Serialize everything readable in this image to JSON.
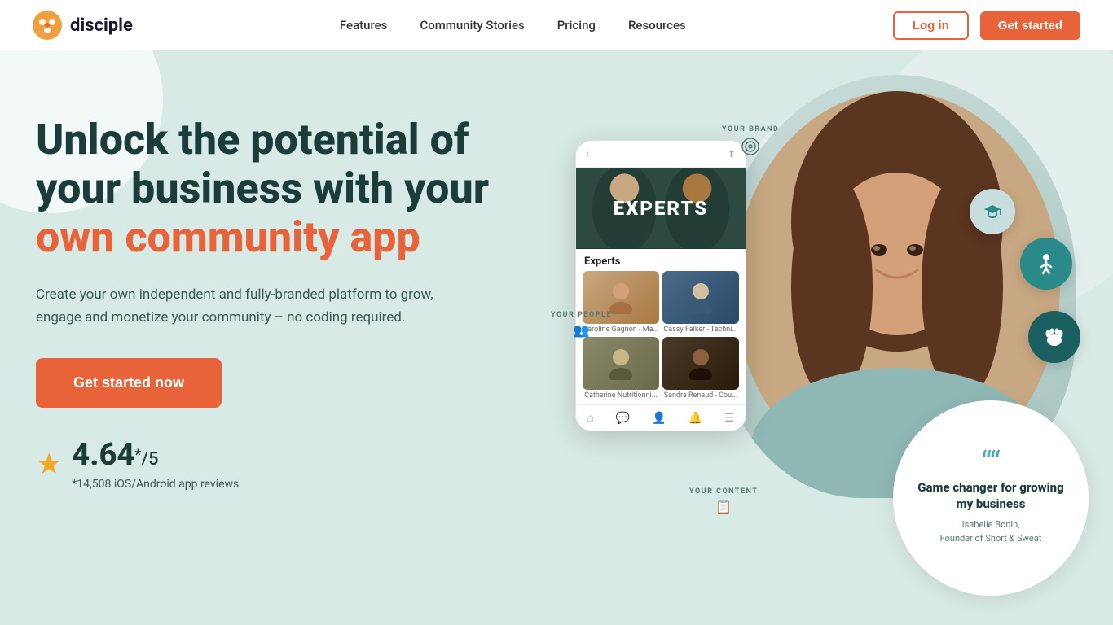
{
  "header": {
    "logo_text": "disciple",
    "nav": [
      {
        "label": "Features",
        "id": "features"
      },
      {
        "label": "Community Stories",
        "id": "community-stories"
      },
      {
        "label": "Pricing",
        "id": "pricing"
      },
      {
        "label": "Resources",
        "id": "resources"
      }
    ],
    "login_label": "Log in",
    "get_started_label": "Get started"
  },
  "hero": {
    "heading_line1": "Unlock the potential of",
    "heading_line2": "your business with your",
    "heading_accent": "own community app",
    "subtext": "Create your own independent and fully-branded platform to grow, engage and monetize your community – no coding required.",
    "cta_label": "Get started now",
    "rating_value": "4.64",
    "rating_sup": "*",
    "rating_denom": "/5",
    "rating_reviews": "*14,508 iOS/Android app reviews"
  },
  "phone": {
    "banner_text": "EXPERTS",
    "section_title": "Experts",
    "cards": [
      {
        "name": "Caroline Gagnon - Ma..."
      },
      {
        "name": "Cassy Falker - Techni..."
      },
      {
        "name": "Catherine Nutritionni..."
      },
      {
        "name": "Sandra Renaud - Cou..."
      }
    ]
  },
  "floating_labels": {
    "brand": "YOUR BRAND",
    "people": "YOUR PEOPLE",
    "content": "YOUR CONTENT"
  },
  "testimonial": {
    "quote_mark": "““",
    "text": "Game changer for growing my business",
    "author": "Isabelle Bonin,\nFounder of Short & Sweat"
  },
  "icons": {
    "cap": "🎓",
    "yoga": "🧘",
    "paws": "🐾",
    "star": "★",
    "brand_icon": "🔑",
    "people_icon": "👥",
    "content_icon": "📋"
  }
}
